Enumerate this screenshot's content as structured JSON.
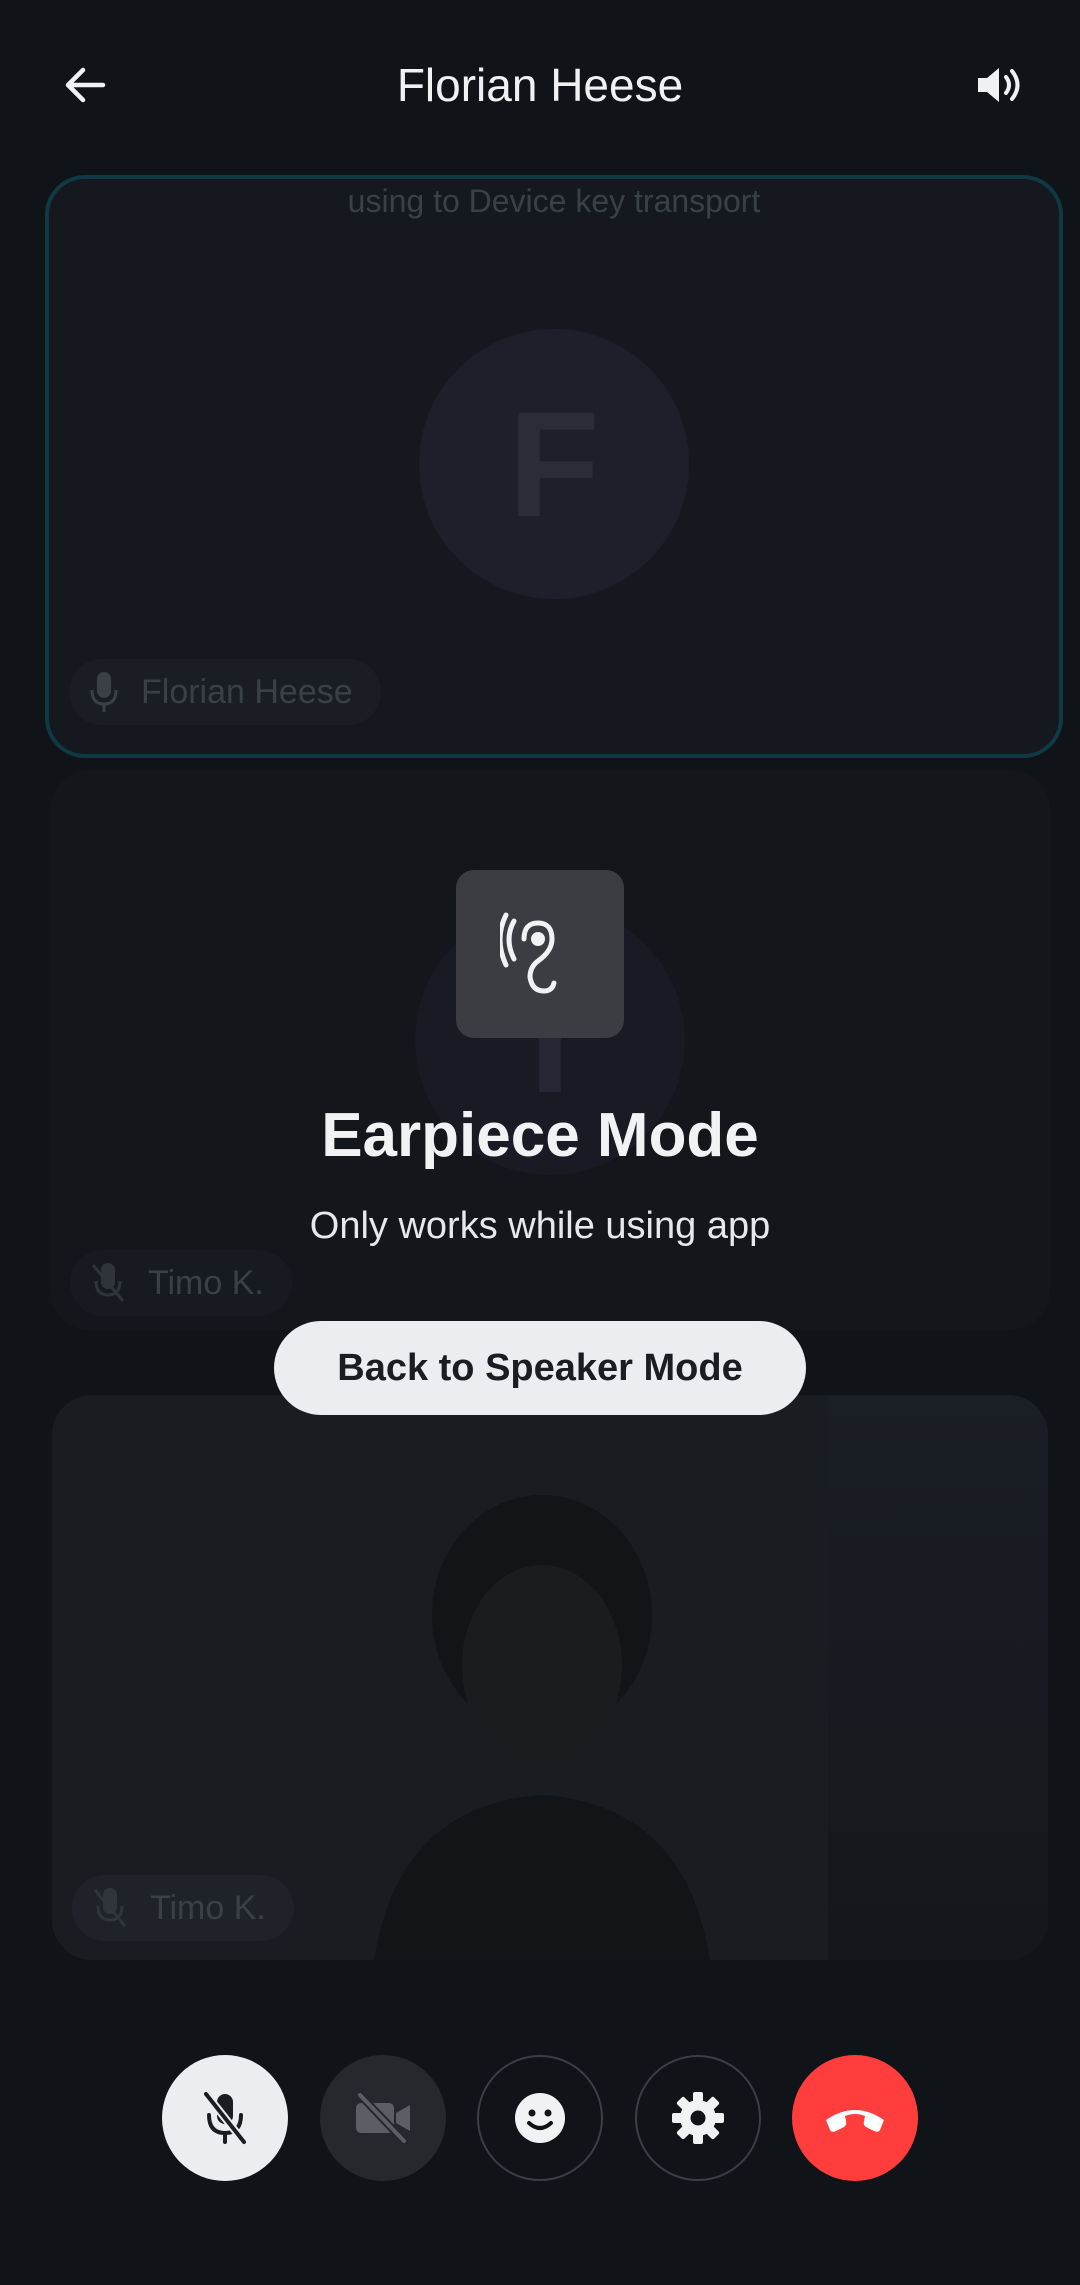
{
  "header": {
    "title": "Florian Heese",
    "back_icon": "arrow-left-icon",
    "speaker_icon": "speaker-volume-icon"
  },
  "tiles": [
    {
      "banner": "using to Device key transport",
      "avatar_letter": "F",
      "name": "Florian Heese",
      "mic_icon": "microphone-icon",
      "border_color": "#0f3a44"
    },
    {
      "avatar_letter": "T",
      "name": "Timo K.",
      "mic_icon": "microphone-muted-icon"
    },
    {
      "name": "Timo K.",
      "mic_icon": "microphone-muted-icon",
      "video": "participant-video"
    }
  ],
  "overlay": {
    "icon": "ear-icon",
    "title": "Earpiece Mode",
    "subtitle": "Only works while using app",
    "button_label": "Back to Speaker Mode"
  },
  "controls": {
    "mic": "microphone-muted-icon",
    "video": "video-off-icon",
    "reaction": "smiley-icon",
    "settings": "gear-icon",
    "hangup": "end-call-icon",
    "hangup_color": "#ff3d3d"
  }
}
